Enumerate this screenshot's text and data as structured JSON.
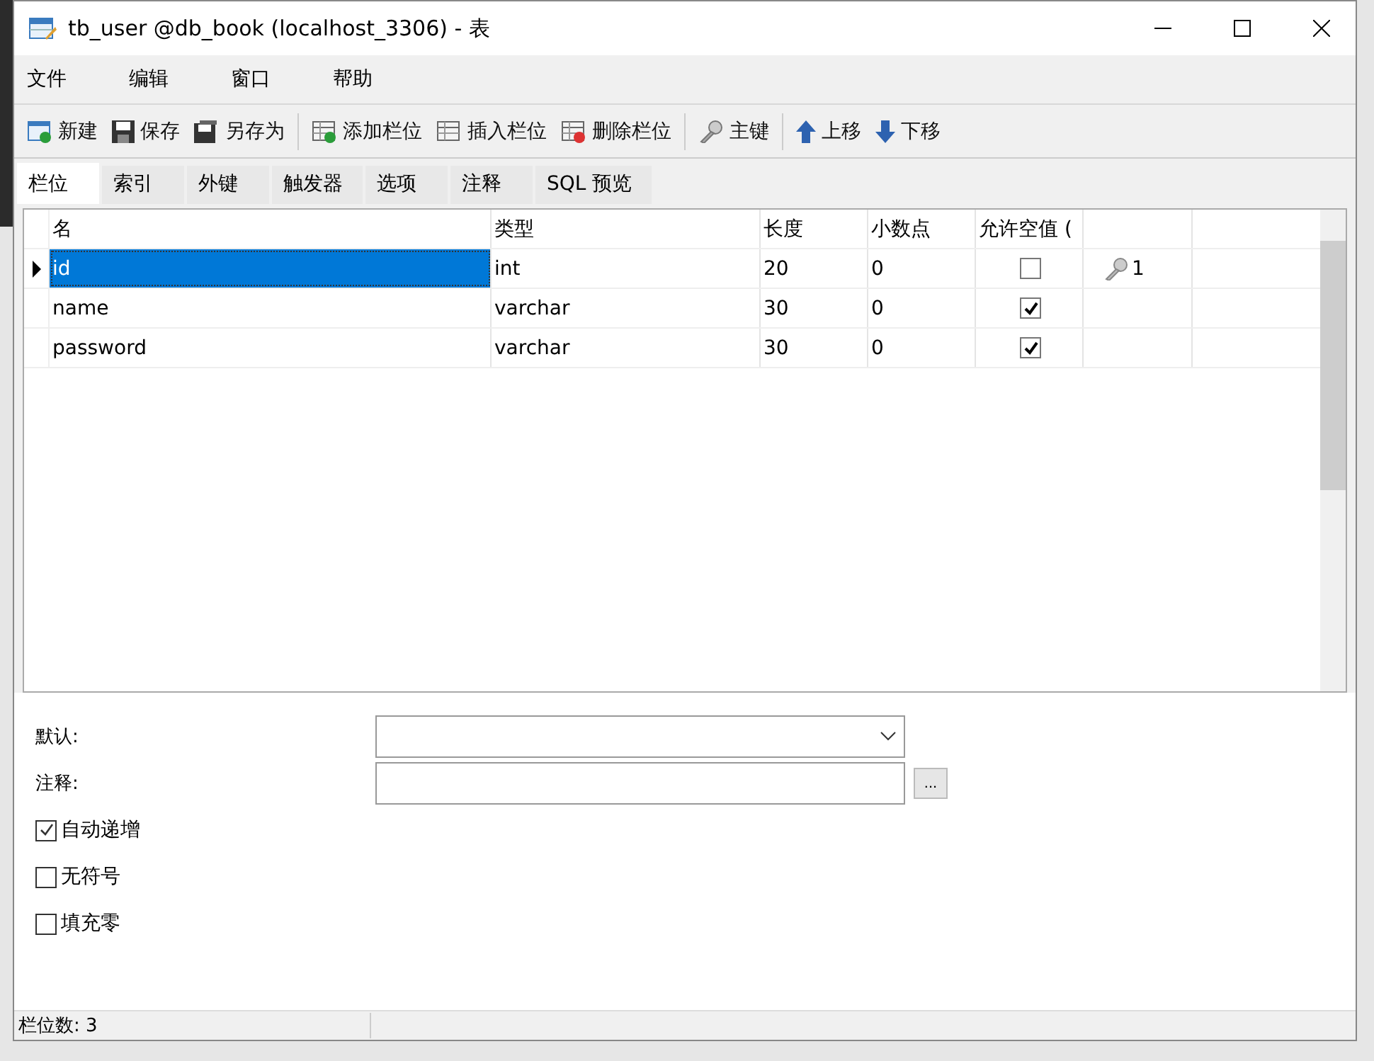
{
  "window": {
    "title": "tb_user @db_book (localhost_3306) - 表"
  },
  "menu": [
    "文件",
    "编辑",
    "窗口",
    "帮助"
  ],
  "toolbar": [
    [
      {
        "kind": "new",
        "label": "新建"
      },
      {
        "kind": "save",
        "label": "保存"
      },
      {
        "kind": "save_as",
        "label": "另存为"
      }
    ],
    [
      {
        "kind": "add_field",
        "label": "添加栏位"
      },
      {
        "kind": "insert_field",
        "label": "插入栏位"
      },
      {
        "kind": "delete_field",
        "label": "删除栏位"
      }
    ],
    [
      {
        "kind": "primary_key",
        "label": "主键"
      }
    ],
    [
      {
        "kind": "move_up",
        "label": "上移"
      },
      {
        "kind": "move_down",
        "label": "下移"
      }
    ]
  ],
  "tabs": [
    {
      "label": "栏位",
      "selected": true
    },
    {
      "label": "索引",
      "selected": false
    },
    {
      "label": "外键",
      "selected": false
    },
    {
      "label": "触发器",
      "selected": false
    },
    {
      "label": "选项",
      "selected": false
    },
    {
      "label": "注释",
      "selected": false
    },
    {
      "label": "SQL 预览",
      "selected": false
    }
  ],
  "table": {
    "columns": [
      "名",
      "类型",
      "长度",
      "小数点",
      "允许空值 ("
    ],
    "rows": [
      {
        "name": "id",
        "type": "int",
        "length": "20",
        "decimals": "0",
        "allow_null": false,
        "primary_key": "1",
        "selected": true
      },
      {
        "name": "name",
        "type": "varchar",
        "length": "30",
        "decimals": "0",
        "allow_null": true,
        "selected": false
      },
      {
        "name": "password",
        "type": "varchar",
        "length": "30",
        "decimals": "0",
        "allow_null": true,
        "selected": false
      }
    ]
  },
  "properties": {
    "default_label": "默认:",
    "comment_label": "注释:",
    "ellipsis": "...",
    "checkboxes": [
      {
        "label": "自动递增",
        "checked": true
      },
      {
        "label": "无符号",
        "checked": false
      },
      {
        "label": "填充零",
        "checked": false
      }
    ]
  },
  "status_bar": "栏位数: 3"
}
